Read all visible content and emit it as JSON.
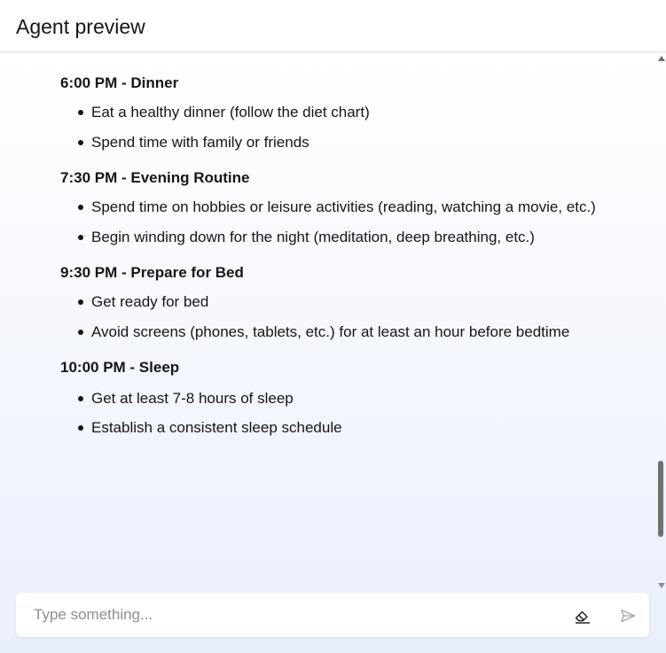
{
  "header": {
    "title": "Agent preview"
  },
  "message": {
    "sections": [
      {
        "heading": "6:00 PM - Dinner",
        "items": [
          "Eat a healthy dinner (follow the diet chart)",
          "Spend time with family or friends"
        ]
      },
      {
        "heading": "7:30 PM - Evening Routine",
        "items": [
          "Spend time on hobbies or leisure activities (reading, watching a movie, etc.)",
          "Begin winding down for the night (meditation, deep breathing, etc.)"
        ]
      },
      {
        "heading": "9:30 PM - Prepare for Bed",
        "items": [
          "Get ready for bed",
          "Avoid screens (phones, tablets, etc.) for at least an hour before bedtime"
        ]
      },
      {
        "heading": "10:00 PM - Sleep",
        "items": [
          "Get at least 7-8 hours of sleep",
          "Establish a consistent sleep schedule"
        ]
      }
    ]
  },
  "input": {
    "placeholder": "Type something...",
    "value": ""
  },
  "icons": {
    "clear": "eraser-icon",
    "send": "send-icon"
  },
  "colors": {
    "text": "#161616",
    "placeholder": "#8d8d8d",
    "icon": "#161616",
    "icon_disabled": "#a8a8a8",
    "background_gradient_end": "#e9effd"
  }
}
